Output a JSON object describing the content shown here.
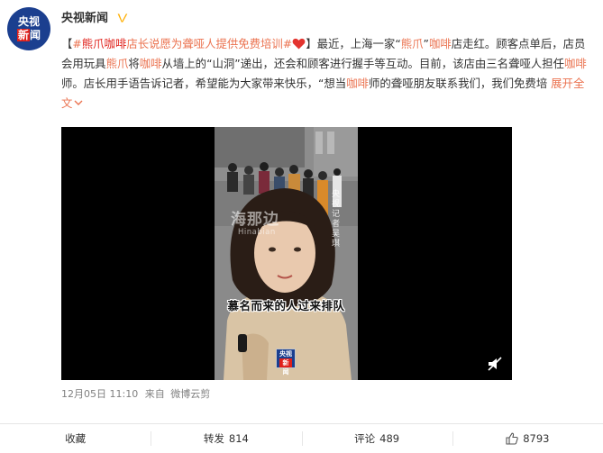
{
  "author": {
    "name": "央视新闻",
    "avatar_text_top": "央视",
    "avatar_text_bottom_red": "新",
    "avatar_text_bottom": "闻"
  },
  "post": {
    "bracket_open": "【",
    "hashtag_prefix": "#",
    "hashtag_highlight": "熊爪咖啡",
    "hashtag_rest": "店长说愿为聋哑人提供免费培训#",
    "bracket_close": "】",
    "text_1": "最近，上海一家“",
    "kw_1": "熊爪",
    "text_2": "”",
    "kw_2": "咖啡",
    "text_3": "店走红。顾客点单后，店员会用玩具",
    "kw_3": "熊爪",
    "text_4": "将",
    "kw_4": "咖啡",
    "text_5": "从墙上的“山洞”递出，还会和顾客进行握手等互动。目前，该店由三名聋哑人担任",
    "kw_5": "咖啡",
    "text_6": "师。店长用手语告诉记者，希望能为大家带来快乐，“想当",
    "kw_6": "咖啡",
    "text_7": "师的聋哑朋友联系我们，我们免费培",
    "expand": "展开全文",
    "expand_icon": "chevron-down-icon"
  },
  "video": {
    "watermark": "海那边",
    "watermark_sub": "Hinabian",
    "side_text": "央视记者 吴琪",
    "subtitle": "慕名而来的人过来排队",
    "badge_top": "央视",
    "badge_bottom_red": "新",
    "badge_bottom": "闻",
    "mute_icon": "mute-icon"
  },
  "meta": {
    "date": "12月05日 11:10",
    "from_label": "来自",
    "source": "微博云剪"
  },
  "actions": {
    "collect": "收藏",
    "repost": "转发",
    "repost_count": "814",
    "comment": "评论",
    "comment_count": "489",
    "like_count": "8793"
  },
  "colors": {
    "accent": "#eb7350",
    "brand_blue": "#1b3f8f",
    "brand_red": "#e0201a"
  }
}
